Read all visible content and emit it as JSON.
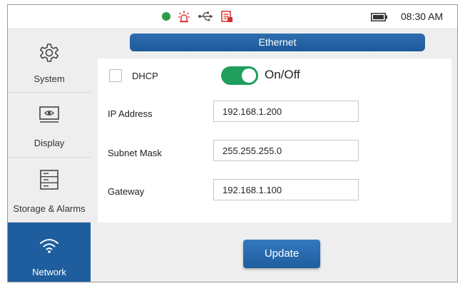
{
  "status_bar": {
    "icons": [
      "status-dot",
      "alarm-icon",
      "usb-icon",
      "report-icon",
      "battery-icon"
    ],
    "time": "08:30 AM"
  },
  "sidebar": {
    "items": [
      {
        "label": "System",
        "icon": "gear-icon",
        "active": false
      },
      {
        "label": "Display",
        "icon": "display-icon",
        "active": false
      },
      {
        "label": "Storage & Alarms",
        "icon": "storage-icon",
        "active": false
      },
      {
        "label": "Network",
        "icon": "wifi-icon",
        "active": true
      }
    ]
  },
  "main": {
    "title": "Ethernet",
    "dhcp": {
      "label": "DHCP",
      "checked": false
    },
    "toggle": {
      "label": "On/Off",
      "on": true
    },
    "fields": [
      {
        "label": "IP Address",
        "value": "192.168.1.200"
      },
      {
        "label": "Subnet Mask",
        "value": "255.255.255.0"
      },
      {
        "label": "Gateway",
        "value": "192.168.1.100"
      }
    ],
    "update_label": "Update"
  },
  "colors": {
    "accent_blue": "#1f5e9e",
    "toggle_green": "#1f9e5d",
    "status_green": "#2e9b45",
    "alert_red": "#d0312d"
  }
}
